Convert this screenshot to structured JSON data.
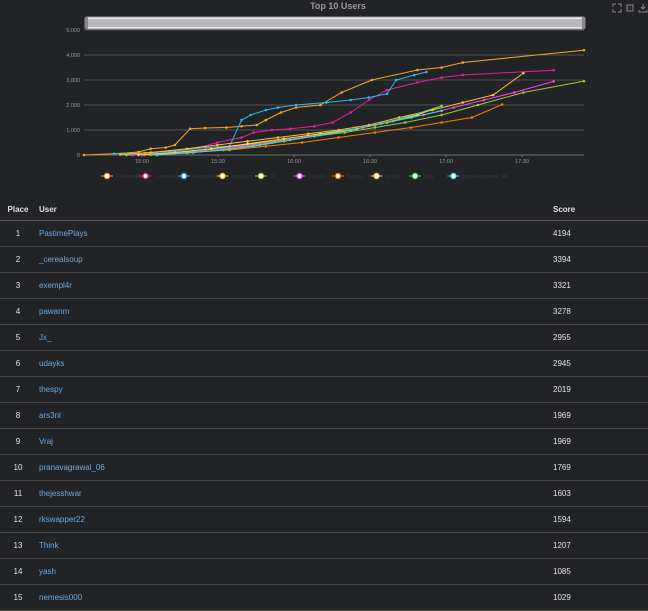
{
  "chart_data": {
    "type": "line",
    "title": "Top 10 Users",
    "x_ticks": [
      "15:00",
      "15:30",
      "16:00",
      "16:30",
      "17:00",
      "17:30"
    ],
    "y_ticks": [
      "0",
      "1,000",
      "2,000",
      "3,000",
      "4,000",
      "5,000"
    ],
    "x_range_minutes": [
      0,
      165
    ],
    "ylim": [
      0,
      5000
    ],
    "grid": true,
    "legend_position": "bottom",
    "series": [
      {
        "name": "PastimePlays",
        "color": "#f5a623",
        "t": [
          0,
          10,
          18,
          22,
          27,
          30,
          35,
          40,
          47,
          52,
          57,
          60,
          65,
          70,
          78,
          85,
          95,
          110,
          118,
          125,
          165
        ],
        "values": [
          0,
          50,
          120,
          250,
          300,
          400,
          1050,
          1080,
          1100,
          1150,
          1200,
          1400,
          1700,
          1900,
          2000,
          2500,
          3000,
          3400,
          3500,
          3700,
          4194
        ]
      },
      {
        "name": "_cerealsoup",
        "color": "#e91e9c",
        "t": [
          14,
          20,
          28,
          38,
          44,
          52,
          56,
          62,
          68,
          76,
          82,
          88,
          94,
          100,
          110,
          118,
          125,
          155
        ],
        "values": [
          50,
          80,
          150,
          300,
          500,
          700,
          900,
          1000,
          1050,
          1150,
          1300,
          1700,
          2200,
          2600,
          2900,
          3100,
          3200,
          3394
        ]
      },
      {
        "name": "exempl4r",
        "color": "#29b6f6",
        "t": [
          10,
          20,
          30,
          40,
          48,
          52,
          55,
          60,
          64,
          70,
          80,
          88,
          94,
          100,
          103,
          109,
          113
        ],
        "values": [
          50,
          80,
          150,
          300,
          350,
          1400,
          1600,
          1800,
          1900,
          2000,
          2100,
          2200,
          2300,
          2450,
          3000,
          3200,
          3321
        ]
      },
      {
        "name": "pawanm",
        "color": "#fbc02d",
        "t": [
          12,
          22,
          34,
          44,
          54,
          64,
          74,
          84,
          94,
          104,
          115,
          125,
          135,
          145
        ],
        "values": [
          20,
          100,
          250,
          400,
          550,
          700,
          850,
          1000,
          1200,
          1500,
          1800,
          2100,
          2400,
          3278
        ]
      },
      {
        "name": "Jx_",
        "color": "#9acd32",
        "t": [
          14,
          24,
          36,
          46,
          56,
          66,
          76,
          86,
          96,
          106,
          118,
          130,
          145,
          165
        ],
        "values": [
          0,
          50,
          150,
          300,
          450,
          600,
          750,
          900,
          1100,
          1300,
          1600,
          2000,
          2500,
          2955
        ]
      },
      {
        "name": "udayks",
        "color": "#ff3cf0",
        "t": [
          16,
          28,
          40,
          52,
          62,
          72,
          82,
          92,
          102,
          112,
          122,
          132,
          142,
          155
        ],
        "values": [
          0,
          80,
          200,
          350,
          500,
          700,
          900,
          1100,
          1350,
          1600,
          1900,
          2200,
          2500,
          2945
        ]
      },
      {
        "name": "thespy",
        "color": "#f57c00",
        "t": [
          20,
          34,
          48,
          60,
          72,
          84,
          96,
          108,
          118,
          128,
          138
        ],
        "values": [
          0,
          100,
          200,
          350,
          500,
          700,
          900,
          1100,
          1300,
          1500,
          2019
        ]
      },
      {
        "name": "ars3nl",
        "color": "#ffd54f",
        "t": [
          18,
          30,
          42,
          54,
          66,
          78,
          90,
          100,
          110,
          118
        ],
        "values": [
          0,
          100,
          250,
          450,
          650,
          850,
          1050,
          1300,
          1600,
          1969
        ]
      },
      {
        "name": "Vraj",
        "color": "#4cd964",
        "t": [
          22,
          34,
          46,
          56,
          66,
          76,
          86,
          96,
          106,
          118
        ],
        "values": [
          0,
          80,
          200,
          350,
          550,
          750,
          950,
          1200,
          1500,
          1969
        ]
      },
      {
        "name": "pranavagrawal_06",
        "color": "#4dd0e1",
        "t": [
          24,
          36,
          48,
          58,
          68,
          78,
          88,
          98,
          108,
          118
        ],
        "values": [
          0,
          100,
          250,
          400,
          600,
          800,
          1000,
          1250,
          1500,
          1769
        ]
      }
    ]
  },
  "table": {
    "headers": {
      "place": "Place",
      "user": "User",
      "score": "Score"
    },
    "rows": [
      {
        "place": "1",
        "user": "PastimePlays",
        "score": "4194"
      },
      {
        "place": "2",
        "user": "_cerealsoup",
        "score": "3394"
      },
      {
        "place": "3",
        "user": "exempl4r",
        "score": "3321"
      },
      {
        "place": "4",
        "user": "pawanm",
        "score": "3278"
      },
      {
        "place": "5",
        "user": "Jx_",
        "score": "2955"
      },
      {
        "place": "6",
        "user": "udayks",
        "score": "2945"
      },
      {
        "place": "7",
        "user": "thespy",
        "score": "2019"
      },
      {
        "place": "8",
        "user": "ars3nl",
        "score": "1969"
      },
      {
        "place": "9",
        "user": "Vraj",
        "score": "1969"
      },
      {
        "place": "10",
        "user": "pranavagrawal_06",
        "score": "1769"
      },
      {
        "place": "11",
        "user": "thejesshwar",
        "score": "1603"
      },
      {
        "place": "12",
        "user": "rkswapper22",
        "score": "1594"
      },
      {
        "place": "13",
        "user": "Think",
        "score": "1207"
      },
      {
        "place": "14",
        "user": "yash",
        "score": "1085"
      },
      {
        "place": "15",
        "user": "nemesis000",
        "score": "1029"
      }
    ]
  },
  "toolbar": {
    "icons": [
      "zoom-select-icon",
      "restore-icon",
      "save-image-icon"
    ]
  }
}
